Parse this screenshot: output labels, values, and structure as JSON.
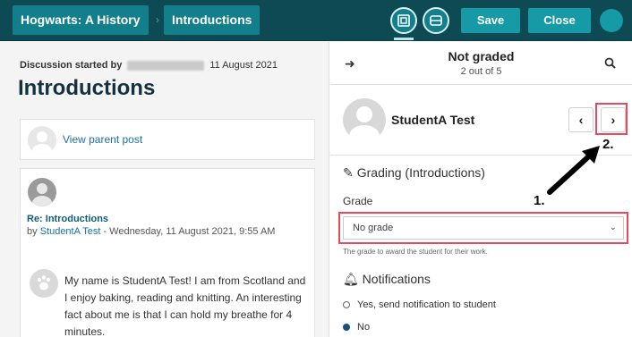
{
  "topbar": {
    "breadcrumbs": [
      "Hogwarts: A History",
      "Introductions"
    ],
    "save_label": "Save",
    "close_label": "Close"
  },
  "discussion": {
    "started_by_label": "Discussion started by",
    "started_date": "11 August 2021",
    "title": "Introductions",
    "parent_link": "View parent post"
  },
  "post": {
    "subject": "Re: Introductions",
    "by_label": "by",
    "author": "StudentA Test",
    "date": " - Wednesday, 11 August 2021, 9:55 AM",
    "body": "My name is StudentA Test! I am from Scotland and I enjoy baking, reading and knitting. An interesting fact about me is that I can hold my breathe for 4 minutes."
  },
  "grader": {
    "status": "Not graded",
    "count": "2 out of 5",
    "student_name": "StudentA Test",
    "grading_heading": "Grading (Introductions)",
    "grade_label": "Grade",
    "grade_value": "No grade",
    "grade_help": "The grade to award the student for their work.",
    "notifications_heading": "Notifications",
    "notify_yes": "Yes, send notification to student",
    "notify_no": "No",
    "notify_selected": "No"
  },
  "annotations": {
    "step1": "1.",
    "step2": "2."
  },
  "colors": {
    "topbar": "#0e4a53",
    "crumb": "#137f8a",
    "button": "#159aa6",
    "highlight": "#e64a5e",
    "link": "#1b6fa8"
  }
}
